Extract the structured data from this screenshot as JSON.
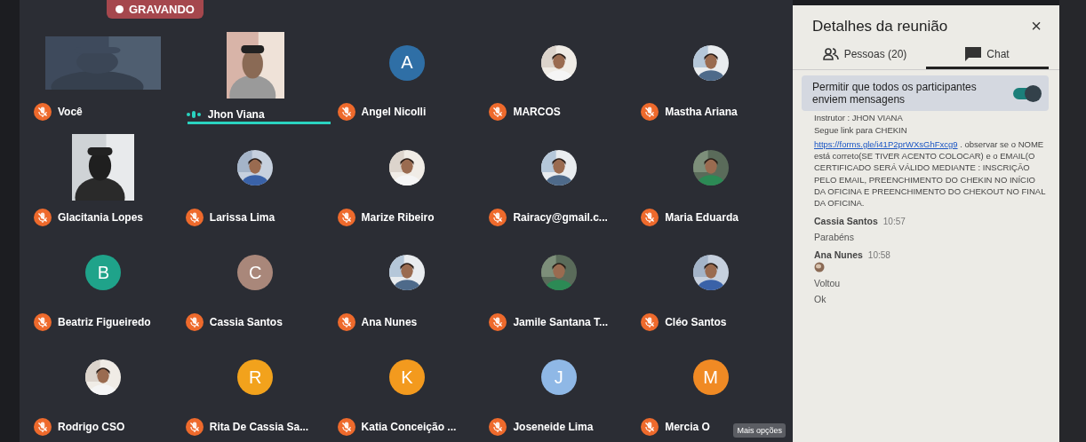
{
  "recording": {
    "label": "GRAVANDO"
  },
  "participants": [
    {
      "name": "Você",
      "kind": "video",
      "muted": true,
      "speaking": false
    },
    {
      "name": "Jhon Viana",
      "kind": "video",
      "muted": false,
      "speaking": true
    },
    {
      "name": "Angel Nicolli",
      "kind": "initial",
      "initial": "A",
      "color": "#2f6fa6",
      "muted": true,
      "speaking": false
    },
    {
      "name": "MARCOS",
      "muted": true,
      "speaking": false
    },
    {
      "name": "Mastha Ariana",
      "muted": true,
      "speaking": false
    },
    {
      "name": "Glacitania Lopes",
      "kind": "video",
      "muted": true,
      "speaking": false
    },
    {
      "name": "Larissa Lima",
      "muted": true,
      "speaking": false
    },
    {
      "name": "Marize Ribeiro",
      "muted": true,
      "speaking": false
    },
    {
      "name": "Rairacy@gmail.c...",
      "muted": true,
      "speaking": false
    },
    {
      "name": "Maria Eduarda",
      "muted": true,
      "speaking": false
    },
    {
      "name": "Beatriz Figueiredo",
      "kind": "initial",
      "initial": "B",
      "color": "#1fa38a",
      "muted": true,
      "speaking": false
    },
    {
      "name": "Cassia Santos",
      "kind": "initial",
      "initial": "C",
      "color": "#a9877a",
      "muted": true,
      "speaking": false
    },
    {
      "name": "Ana Nunes",
      "muted": true,
      "speaking": false
    },
    {
      "name": "Jamile Santana T...",
      "muted": true,
      "speaking": false
    },
    {
      "name": "Cléo Santos",
      "muted": true,
      "speaking": false
    },
    {
      "name": "Rodrigo CSO",
      "muted": true,
      "speaking": false
    },
    {
      "name": "Rita De Cassia Sa...",
      "kind": "initial",
      "initial": "R",
      "color": "#f2a21c",
      "muted": true,
      "speaking": false
    },
    {
      "name": "Katia Conceição ...",
      "kind": "initial",
      "initial": "K",
      "color": "#f39a1e",
      "muted": true,
      "speaking": false
    },
    {
      "name": "Joseneide Lima",
      "kind": "initial",
      "initial": "J",
      "color": "#8fb8e6",
      "muted": true,
      "speaking": false
    },
    {
      "name": "Mercia O",
      "kind": "initial",
      "initial": "M",
      "color": "#f08a24",
      "muted": true,
      "speaking": false
    }
  ],
  "tooltip": "Mais opções",
  "panel": {
    "title": "Detalhes da reunião",
    "close": "×",
    "tabs": [
      {
        "label": "Pessoas (20)",
        "kind": "people",
        "selected": false
      },
      {
        "label": "Chat",
        "kind": "chat",
        "selected": true
      }
    ],
    "toggle": {
      "label": "Permitir que todos os participantes enviem mensagens",
      "on": true
    },
    "messages": [
      {
        "lines": [
          "Instrutor : JHON VIANA",
          "Segue link para CHEKIN"
        ],
        "link": "https://forms.gle/i41P2prWXsGhFxcg9",
        "text": " . observar se o NOME está correto(SE TIVER ACENTO COLOCAR) e o EMAIL(O CERTIFICADO SERÁ VÁLIDO MEDIANTE : INSCRIÇÃO PELO EMAIL, PREENCHIMENTO DO CHEKIN NO INÍCIO DA OFICINA E PREENCHIMENTO DO CHEKOUT NO FINAL DA OFICINA."
      },
      {
        "sender": "Cassia Santos",
        "time": "10:57",
        "lines": [
          "Parabéns"
        ]
      },
      {
        "sender": "Ana Nunes",
        "time": "10:58",
        "emoji": true,
        "lines": [
          "Voltou",
          "Ok"
        ]
      }
    ]
  }
}
